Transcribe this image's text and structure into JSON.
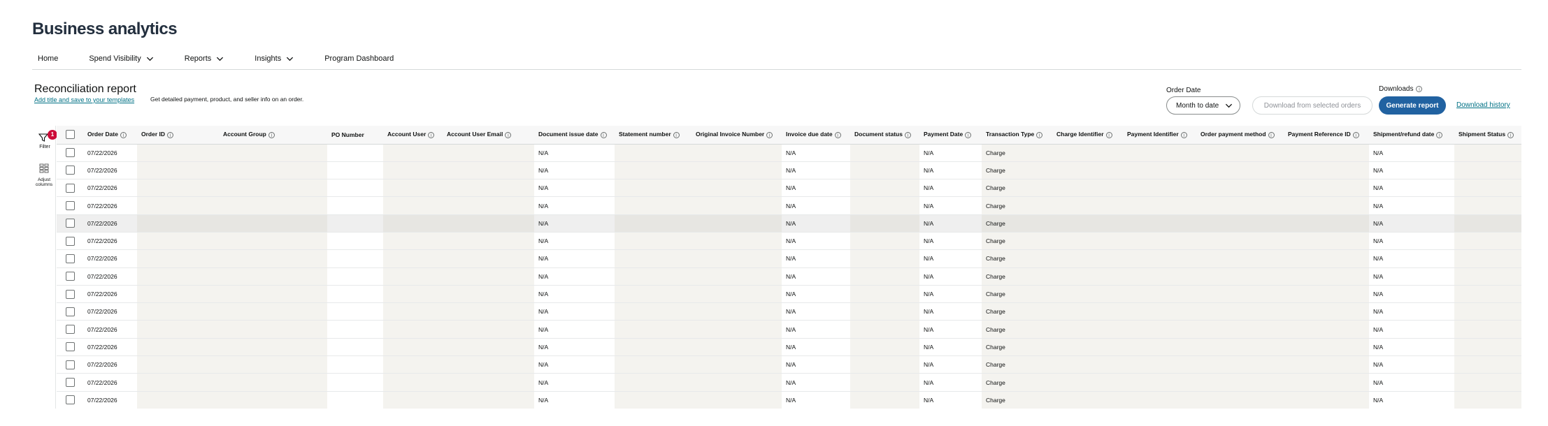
{
  "app": {
    "title": "Business analytics"
  },
  "nav": [
    {
      "label": "Home",
      "has_dropdown": false
    },
    {
      "label": "Spend Visibility",
      "has_dropdown": true
    },
    {
      "label": "Reports",
      "has_dropdown": true
    },
    {
      "label": "Insights",
      "has_dropdown": true
    },
    {
      "label": "Program Dashboard",
      "has_dropdown": false
    }
  ],
  "report": {
    "title": "Reconciliation report",
    "template_link": "Add title and save to your templates",
    "description": "Get detailed payment, product, and seller info on an order."
  },
  "controls": {
    "order_date_label": "Order Date",
    "order_date_value": "Month to date",
    "download_selected": "Download from selected orders",
    "downloads_label": "Downloads",
    "generate": "Generate report",
    "history": "Download history"
  },
  "sidebar": {
    "filter_label": "Filter",
    "filter_count": "1",
    "adjust_label_1": "Adjust",
    "adjust_label_2": "columns"
  },
  "colors": {
    "primary_button": "#2162a1",
    "link": "#007185",
    "badge": "#cc0c39"
  },
  "table": {
    "columns": [
      "Order Date",
      "Order ID",
      "Account Group",
      "PO Number",
      "Account User",
      "Account User Email",
      "Document issue date",
      "Statement number",
      "Original Invoice Number",
      "Invoice due date",
      "Document status",
      "Payment Date",
      "Transaction Type",
      "Charge Identifier",
      "Payment Identifier",
      "Order payment method",
      "Payment Reference ID",
      "Shipment/refund date",
      "Shipment Status"
    ],
    "rows": [
      {
        "order_date": "07/22/2026",
        "document_issue_date": "N/A",
        "invoice_due_date": "N/A",
        "payment_date": "N/A",
        "transaction_type": "Charge",
        "shipment_refund_date": "N/A"
      },
      {
        "order_date": "07/22/2026",
        "document_issue_date": "N/A",
        "invoice_due_date": "N/A",
        "payment_date": "N/A",
        "transaction_type": "Charge",
        "shipment_refund_date": "N/A"
      },
      {
        "order_date": "07/22/2026",
        "document_issue_date": "N/A",
        "invoice_due_date": "N/A",
        "payment_date": "N/A",
        "transaction_type": "Charge",
        "shipment_refund_date": "N/A"
      },
      {
        "order_date": "07/22/2026",
        "document_issue_date": "N/A",
        "invoice_due_date": "N/A",
        "payment_date": "N/A",
        "transaction_type": "Charge",
        "shipment_refund_date": "N/A"
      },
      {
        "order_date": "07/22/2026",
        "document_issue_date": "N/A",
        "invoice_due_date": "N/A",
        "payment_date": "N/A",
        "transaction_type": "Charge",
        "shipment_refund_date": "N/A"
      },
      {
        "order_date": "07/22/2026",
        "document_issue_date": "N/A",
        "invoice_due_date": "N/A",
        "payment_date": "N/A",
        "transaction_type": "Charge",
        "shipment_refund_date": "N/A"
      },
      {
        "order_date": "07/22/2026",
        "document_issue_date": "N/A",
        "invoice_due_date": "N/A",
        "payment_date": "N/A",
        "transaction_type": "Charge",
        "shipment_refund_date": "N/A"
      },
      {
        "order_date": "07/22/2026",
        "document_issue_date": "N/A",
        "invoice_due_date": "N/A",
        "payment_date": "N/A",
        "transaction_type": "Charge",
        "shipment_refund_date": "N/A"
      },
      {
        "order_date": "07/22/2026",
        "document_issue_date": "N/A",
        "invoice_due_date": "N/A",
        "payment_date": "N/A",
        "transaction_type": "Charge",
        "shipment_refund_date": "N/A"
      },
      {
        "order_date": "07/22/2026",
        "document_issue_date": "N/A",
        "invoice_due_date": "N/A",
        "payment_date": "N/A",
        "transaction_type": "Charge",
        "shipment_refund_date": "N/A"
      },
      {
        "order_date": "07/22/2026",
        "document_issue_date": "N/A",
        "invoice_due_date": "N/A",
        "payment_date": "N/A",
        "transaction_type": "Charge",
        "shipment_refund_date": "N/A"
      },
      {
        "order_date": "07/22/2026",
        "document_issue_date": "N/A",
        "invoice_due_date": "N/A",
        "payment_date": "N/A",
        "transaction_type": "Charge",
        "shipment_refund_date": "N/A"
      },
      {
        "order_date": "07/22/2026",
        "document_issue_date": "N/A",
        "invoice_due_date": "N/A",
        "payment_date": "N/A",
        "transaction_type": "Charge",
        "shipment_refund_date": "N/A"
      },
      {
        "order_date": "07/22/2026",
        "document_issue_date": "N/A",
        "invoice_due_date": "N/A",
        "payment_date": "N/A",
        "transaction_type": "Charge",
        "shipment_refund_date": "N/A"
      },
      {
        "order_date": "07/22/2026",
        "document_issue_date": "N/A",
        "invoice_due_date": "N/A",
        "payment_date": "N/A",
        "transaction_type": "Charge",
        "shipment_refund_date": "N/A"
      }
    ]
  }
}
